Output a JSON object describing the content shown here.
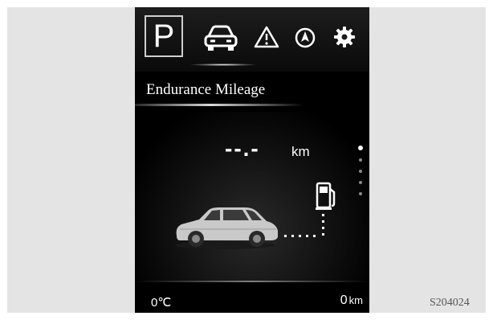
{
  "cluster": {
    "gear": "P",
    "tabs": [
      {
        "id": "vehicle",
        "icon": "car-icon",
        "active": true
      },
      {
        "id": "warnings",
        "icon": "warning-triangle-icon",
        "active": false
      },
      {
        "id": "navigation",
        "icon": "navigation-compass-icon",
        "active": false
      },
      {
        "id": "settings",
        "icon": "gear-icon",
        "active": false
      }
    ],
    "section_title": "Endurance Mileage",
    "range_value": "--.-",
    "range_unit": "km",
    "page_indicator": {
      "total": 5,
      "active_index": 0
    },
    "fuel_icon": "fuel-pump-icon",
    "car_image": "suv-car-image",
    "status_bar": {
      "temperature": "0℃",
      "odometer_value": "0",
      "odometer_unit": "km"
    },
    "colors": {
      "screen_bg": "#000000",
      "text": "#ffffff",
      "page_bg": "#e4e4e4"
    }
  },
  "figure_code": "S204024"
}
